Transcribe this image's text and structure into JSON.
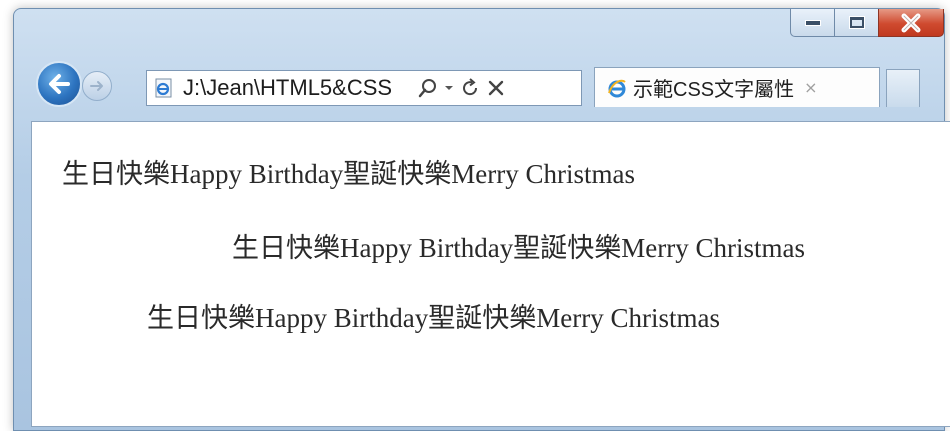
{
  "browser": {
    "address_url": "J:\\Jean\\HTML5&CSS",
    "tab_title": "示範CSS文字屬性",
    "tab_close_glyph": "×",
    "controls": {
      "minimize": "minimize",
      "maximize": "maximize",
      "close": "close"
    }
  },
  "page": {
    "lines": [
      "生日快樂Happy Birthday聖誕快樂Merry Christmas",
      "生日快樂Happy Birthday聖誕快樂Merry Christmas",
      "生日快樂Happy Birthday聖誕快樂Merry Christmas"
    ]
  },
  "colors": {
    "accent": "#2d74c0",
    "close_button": "#cf4a2f",
    "chrome": "#b4cde6"
  }
}
